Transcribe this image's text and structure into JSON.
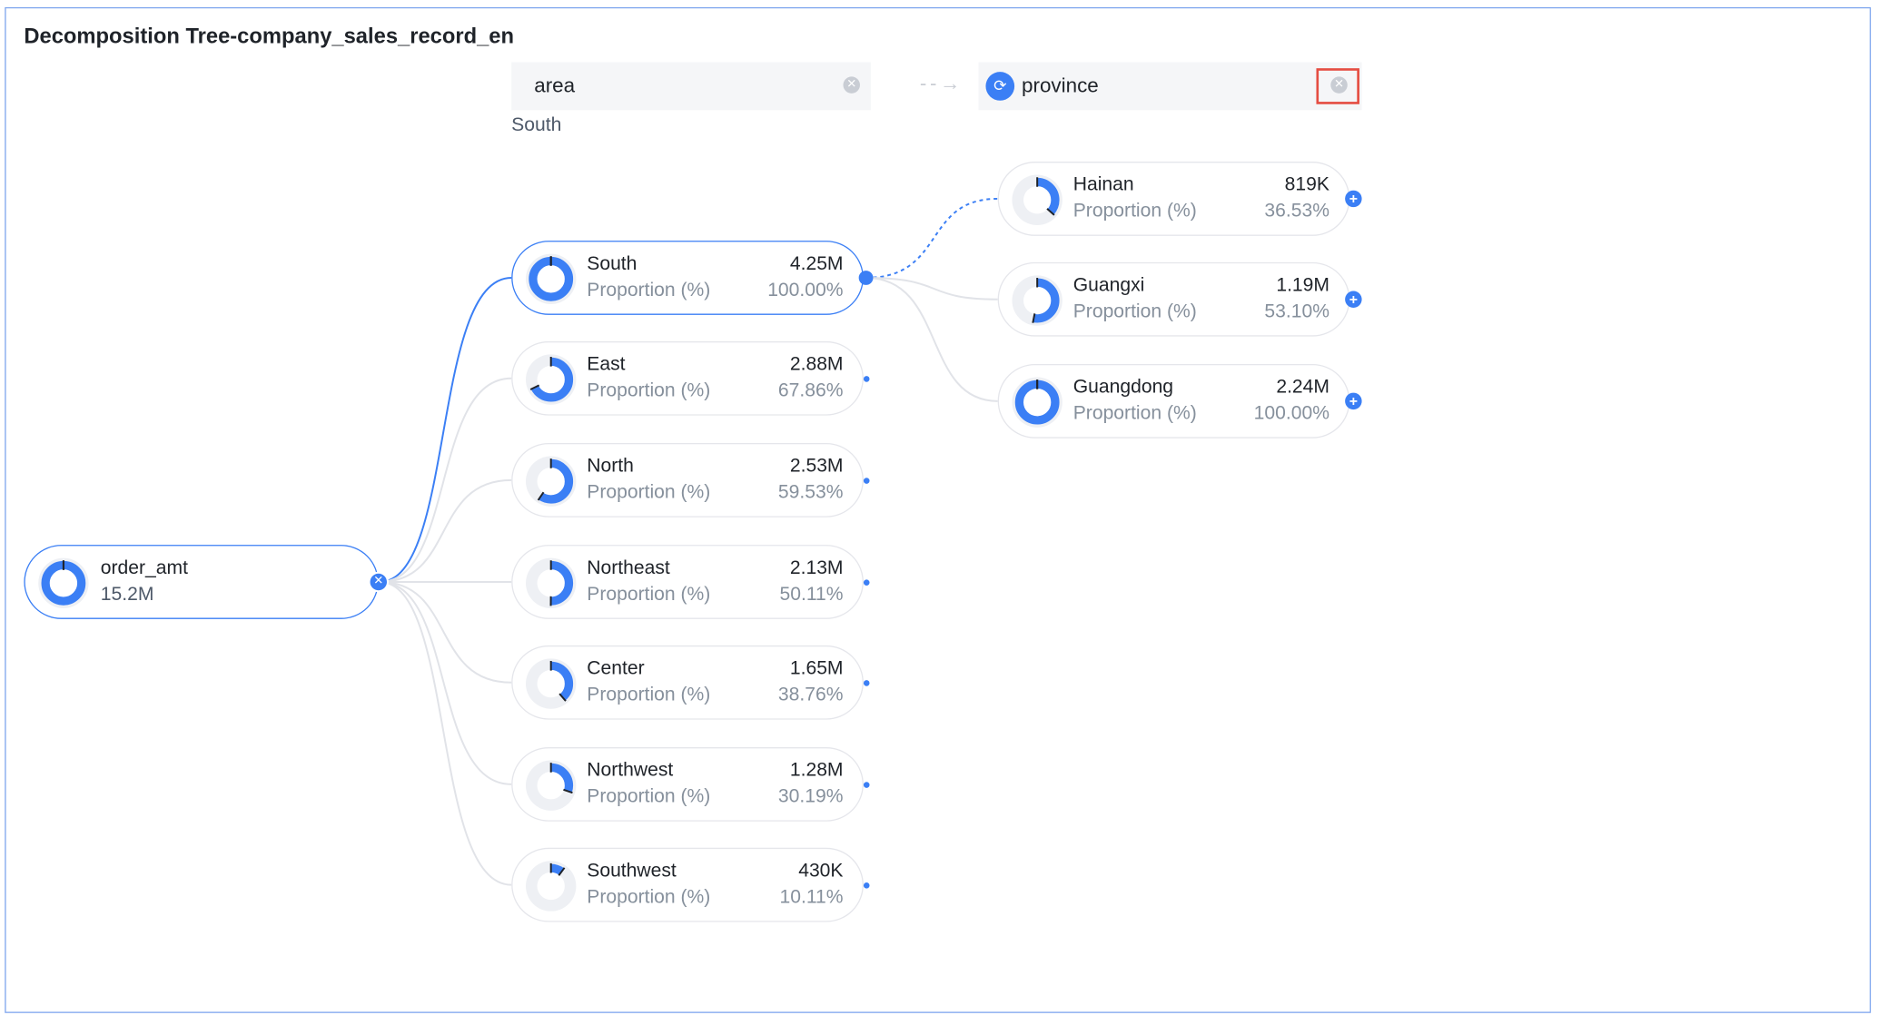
{
  "title": "Decomposition Tree-company_sales_record_en",
  "levels": [
    {
      "label": "area",
      "selected": "South"
    },
    {
      "label": "province"
    }
  ],
  "root": {
    "name": "order_amt",
    "value": "15.2M",
    "fraction": 1.0
  },
  "areas": [
    {
      "name": "South",
      "value": "4.25M",
      "pct_label": "Proportion (%)",
      "pct": "100.00%",
      "fraction": 1.0,
      "selected": true
    },
    {
      "name": "East",
      "value": "2.88M",
      "pct_label": "Proportion (%)",
      "pct": "67.86%",
      "fraction": 0.6786
    },
    {
      "name": "North",
      "value": "2.53M",
      "pct_label": "Proportion (%)",
      "pct": "59.53%",
      "fraction": 0.5953
    },
    {
      "name": "Northeast",
      "value": "2.13M",
      "pct_label": "Proportion (%)",
      "pct": "50.11%",
      "fraction": 0.5011
    },
    {
      "name": "Center",
      "value": "1.65M",
      "pct_label": "Proportion (%)",
      "pct": "38.76%",
      "fraction": 0.3876
    },
    {
      "name": "Northwest",
      "value": "1.28M",
      "pct_label": "Proportion (%)",
      "pct": "30.19%",
      "fraction": 0.3019
    },
    {
      "name": "Southwest",
      "value": "430K",
      "pct_label": "Proportion (%)",
      "pct": "10.11%",
      "fraction": 0.1011
    }
  ],
  "provinces": [
    {
      "name": "Hainan",
      "value": "819K",
      "pct_label": "Proportion (%)",
      "pct": "36.53%",
      "fraction": 0.3653
    },
    {
      "name": "Guangxi",
      "value": "1.19M",
      "pct_label": "Proportion (%)",
      "pct": "53.10%",
      "fraction": 0.531
    },
    {
      "name": "Guangdong",
      "value": "2.24M",
      "pct_label": "Proportion (%)",
      "pct": "100.00%",
      "fraction": 1.0
    }
  ],
  "colors": {
    "accent": "#3b7ff5",
    "track": "#eef0f4",
    "highlight": "#e54d42"
  }
}
